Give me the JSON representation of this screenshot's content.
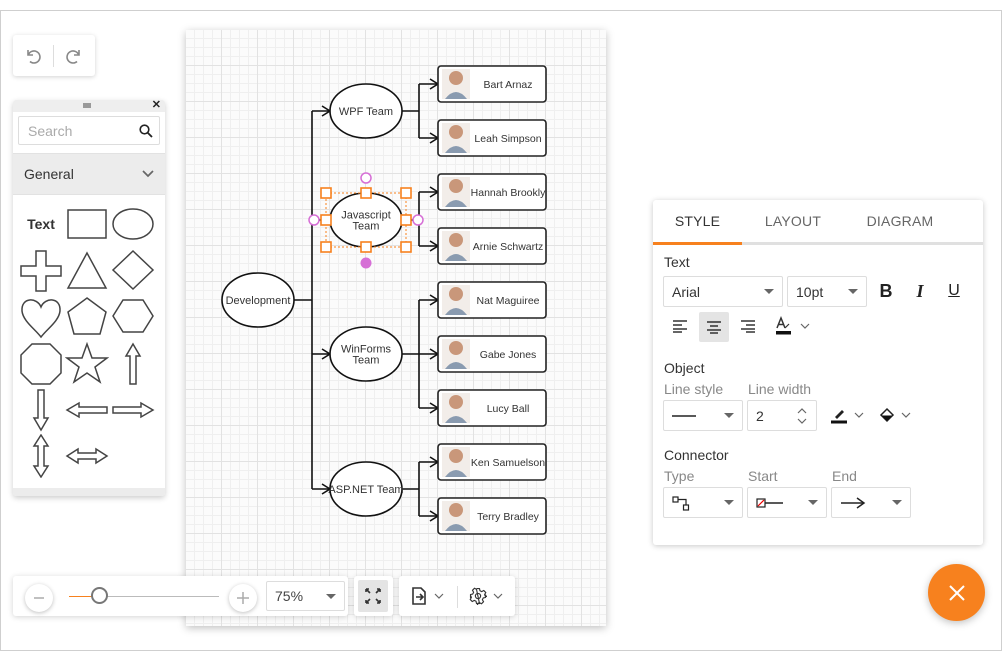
{
  "toolbar_top": {
    "undo_label": "Undo",
    "redo_label": "Redo"
  },
  "palette": {
    "search_placeholder": "Search",
    "group_title": "General",
    "text_shape_label": "Text",
    "shapes": [
      "Text",
      "Rectangle",
      "Ellipse",
      "Plus",
      "Triangle",
      "Diamond",
      "Heart",
      "Pentagon",
      "Hexagon",
      "Octagon",
      "Star",
      "Arrow Up",
      "Arrow Down",
      "Arrow Left",
      "Arrow Right",
      "Double Arrow Vertical",
      "Double Arrow Horizontal"
    ]
  },
  "diagram": {
    "root": "Development",
    "teams": [
      {
        "name": "WPF Team",
        "lines": [
          "WPF Team"
        ],
        "members": [
          "Bart Arnaz",
          "Leah Simpson"
        ],
        "selected": false
      },
      {
        "name": "Javascript Team",
        "lines": [
          "Javascript",
          "Team"
        ],
        "members": [
          "Hannah Brookly",
          "Arnie Schwartz"
        ],
        "selected": true
      },
      {
        "name": "WinForms Team",
        "lines": [
          "WinForms",
          "Team"
        ],
        "members": [
          "Nat Maguiree",
          "Gabe Jones",
          "Lucy Ball"
        ],
        "selected": false
      },
      {
        "name": "ASP.NET Team",
        "lines": [
          "ASP.NET Team"
        ],
        "members": [
          "Ken Samuelson",
          "Terry Bradley"
        ],
        "selected": false
      }
    ],
    "colors": {
      "selection": "#f7811e",
      "pin": "#d66fd6"
    }
  },
  "zoombar": {
    "zoom_value": "75%",
    "zoom_fraction": 0.2
  },
  "props": {
    "tabs": [
      "STYLE",
      "LAYOUT",
      "DIAGRAM"
    ],
    "active_tab": "STYLE",
    "text_section": "Text",
    "font_family": "Arial",
    "font_size": "10pt",
    "bold": "B",
    "italic": "I",
    "underline": "U",
    "alignment": "center",
    "object_section": "Object",
    "line_style_label": "Line style",
    "line_width_label": "Line width",
    "line_width_value": "2",
    "connector_section": "Connector",
    "type_label": "Type",
    "start_label": "Start",
    "end_label": "End"
  },
  "fab": {
    "icon": "close-icon"
  },
  "colors": {
    "accent": "#f7811e"
  }
}
